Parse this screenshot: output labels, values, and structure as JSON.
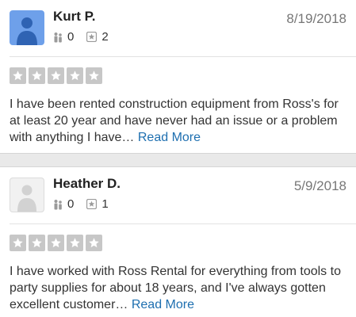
{
  "reviews": [
    {
      "name": "Kurt P.",
      "date": "8/19/2018",
      "friends": "0",
      "reviews_count": "2",
      "rating": 5,
      "avatar": "user-silhouette-blue",
      "text": "I have been rented construction equipment from Ross's for at least 20 year and have never had an issue or a problem with anything I have…",
      "read_more": "Read More"
    },
    {
      "name": "Heather D.",
      "date": "5/9/2018",
      "friends": "0",
      "reviews_count": "1",
      "rating": 5,
      "avatar": "user-silhouette-gray",
      "text": "I have worked with Ross Rental for everything from tools to party supplies for about 18 years, and I've always gotten excellent customer…",
      "read_more": "Read More"
    }
  ],
  "colors": {
    "star_empty": "#c7c7c7",
    "link": "#1e6fb0",
    "avatar_blue": "#6ea0ea"
  }
}
